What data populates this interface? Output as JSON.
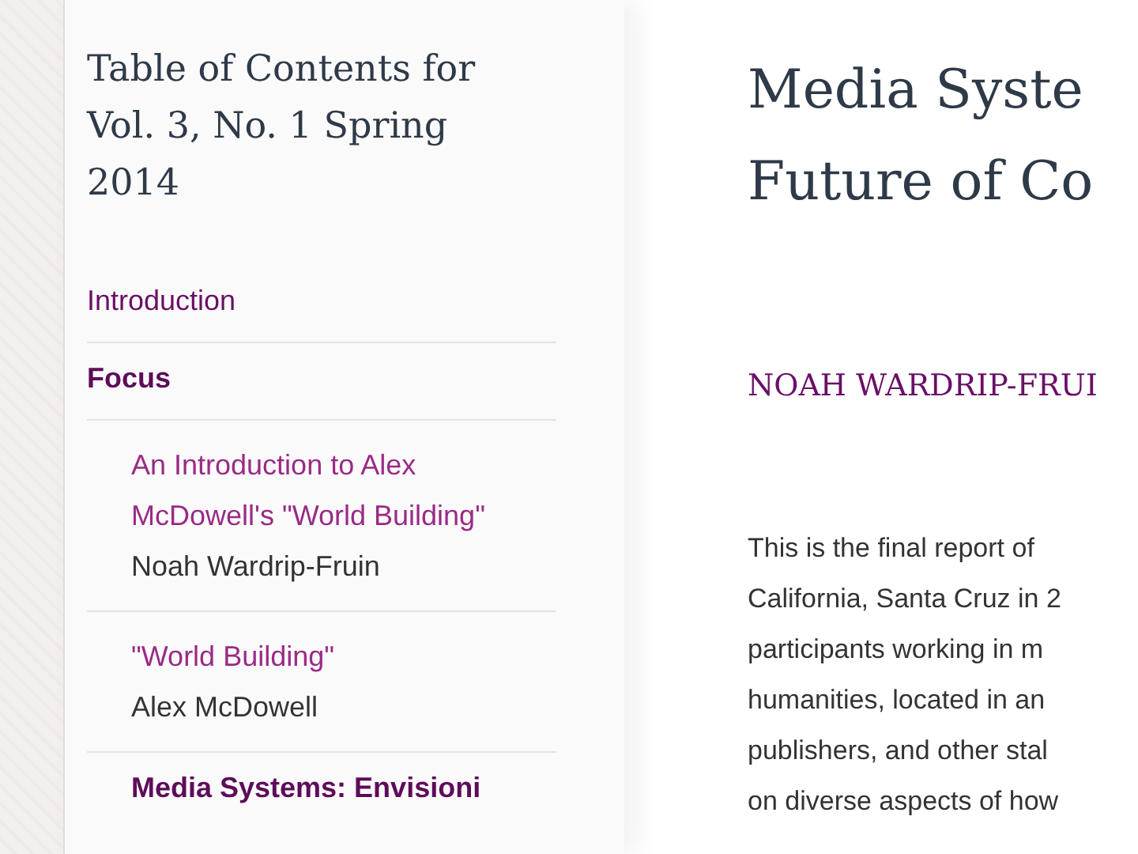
{
  "toc": {
    "title": "Table of Contents for Vol. 3, No. 1 Spring 2014",
    "items": [
      {
        "kind": "link",
        "title": "Introduction"
      },
      {
        "kind": "section",
        "title": "Focus",
        "children": [
          {
            "kind": "article",
            "title": "An Introduction to Alex McDowell's \"World Building\"",
            "author": "Noah Wardrip-Fruin"
          },
          {
            "kind": "article",
            "title": "\"World Building\"",
            "author": "Alex McDowell"
          },
          {
            "kind": "section",
            "title": "Media Systems: Envisioni"
          }
        ]
      }
    ]
  },
  "article": {
    "title_lines": [
      "Media Syste",
      "Future of Co"
    ],
    "author": "NOAH WARDRIP-FRUI",
    "body_lines": [
      "This is the final report of",
      "California, Santa Cruz in 2",
      "participants working in m",
      "humanities, located in an",
      "publishers, and other stal",
      "on diverse aspects of how"
    ]
  }
}
